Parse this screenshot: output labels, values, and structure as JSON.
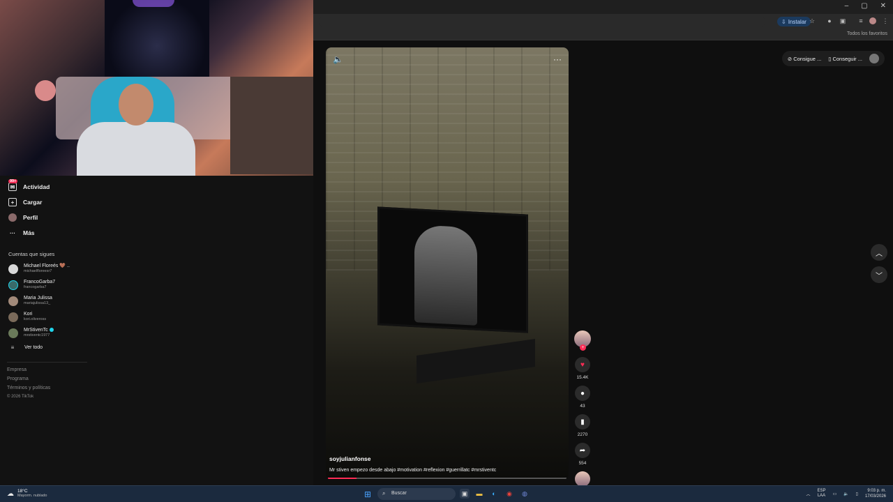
{
  "browser": {
    "install_label": "Instalar",
    "bookmarks_all": "Todos los favoritos",
    "window_controls": [
      "–",
      "▢",
      "✕"
    ]
  },
  "sidebar": {
    "nav": [
      {
        "label": "Actividad",
        "icon": "activity-icon",
        "badge": "99+"
      },
      {
        "label": "Cargar",
        "icon": "upload-icon"
      },
      {
        "label": "Perfil",
        "icon": "profile-icon"
      },
      {
        "label": "Más",
        "icon": "more-icon"
      }
    ],
    "following_title": "Cuentas que sigues",
    "following": [
      {
        "name": "Michael Floreés 🤎 ..",
        "handle": "michaelfloreesr7"
      },
      {
        "name": "FrancoGarba7",
        "handle": "francogarba7"
      },
      {
        "name": "Maria Julissa",
        "handle": "mariajulissa13_"
      },
      {
        "name": "Kori",
        "handle": "kori.oliveross"
      },
      {
        "name": "MrStivenTc",
        "handle": "mrstiventc1977",
        "verified": true
      }
    ],
    "see_all": "Ver todo",
    "footer": [
      "Empresa",
      "Programa",
      "Términos y políticas",
      "© 2026 TikTok"
    ]
  },
  "top_pills": {
    "get_coins": "Consigue ...",
    "get_app": "Conseguir ..."
  },
  "video": {
    "author": "soyjulianfonse",
    "caption": "Mr stiven empezo desde abajo #motivation #reflexion #guerrillatc #mrstiventc",
    "progress": 0.12
  },
  "actions": {
    "likes": "15.4K",
    "comments": "43",
    "saves": "2270",
    "shares": "554"
  },
  "taskbar": {
    "temp": "18°C",
    "condition": "Mayorm. nublado",
    "search_label": "Buscar",
    "lang": "ESP",
    "lang_sub": "LAA",
    "time": "9:03 p. m.",
    "date": "17/03/2026"
  },
  "colors": {
    "accent": "#fe2c55",
    "verified": "#20d5ec",
    "taskbar": "#1b2a3e"
  }
}
